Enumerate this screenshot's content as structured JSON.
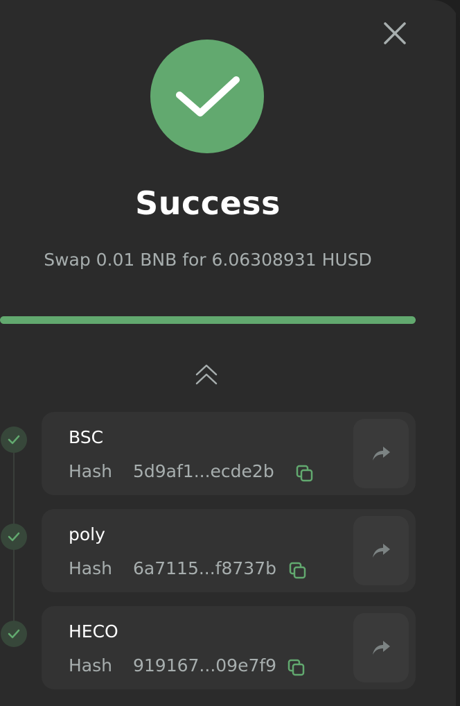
{
  "dialog": {
    "title": "Success",
    "message": "Swap 0.01 BNB for 6.06308931 HUSD",
    "progress_percent": 100
  },
  "steps": [
    {
      "chain": "BSC",
      "hash_label": "Hash",
      "hash": "5d9af1...ecde2b",
      "status": "complete"
    },
    {
      "chain": "poly",
      "hash_label": "Hash",
      "hash": "6a7115...f8737b",
      "status": "complete"
    },
    {
      "chain": "HECO",
      "hash_label": "Hash",
      "hash": "919167...09e7f9",
      "status": "complete"
    }
  ],
  "icons": {
    "close": "close-icon",
    "success": "checkmark-icon",
    "collapse": "double-chevron-up-icon",
    "copy": "copy-icon",
    "share": "share-arrow-icon",
    "step_status": "check-icon"
  },
  "colors": {
    "accent": "#62a96f",
    "panel_bg": "#2b2b2b",
    "card_bg": "#333333",
    "text_primary": "#ffffff",
    "text_secondary": "#a7aeae"
  }
}
